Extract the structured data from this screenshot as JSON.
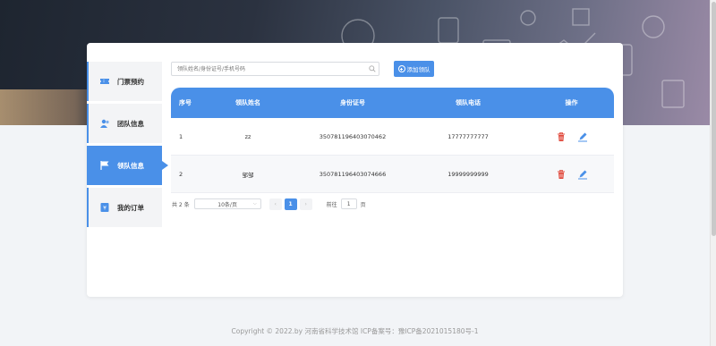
{
  "sidebar": {
    "items": [
      {
        "label": "门票预约",
        "icon": "ticket-icon"
      },
      {
        "label": "团队信息",
        "icon": "team-icon"
      },
      {
        "label": "领队信息",
        "icon": "flag-icon",
        "active": true
      },
      {
        "label": "我的订单",
        "icon": "order-icon"
      }
    ]
  },
  "toolbar": {
    "search_placeholder": "领队姓名/身份证号/手机号码",
    "add_label": "添加领队"
  },
  "table": {
    "headers": [
      "序号",
      "领队姓名",
      "身份证号",
      "领队电话",
      "操作"
    ],
    "rows": [
      {
        "no": "1",
        "name": "zz",
        "id": "350781196403070462",
        "phone": "17777777777"
      },
      {
        "no": "2",
        "name": "邹邹",
        "id": "350781196403074666",
        "phone": "19999999999"
      }
    ]
  },
  "pagination": {
    "total": "共 2 条",
    "page_size": "10条/页",
    "prev": "‹",
    "page": "1",
    "next": "›",
    "goto_label": "前往",
    "goto_value": "1",
    "page_unit": "页"
  },
  "footer": {
    "text": "Copyright © 2022.by 河南省科学技术馆 ICP备案号：豫ICP备2021015180号-1"
  },
  "colors": {
    "accent": "#4a90e8",
    "delete": "#e0483b"
  }
}
